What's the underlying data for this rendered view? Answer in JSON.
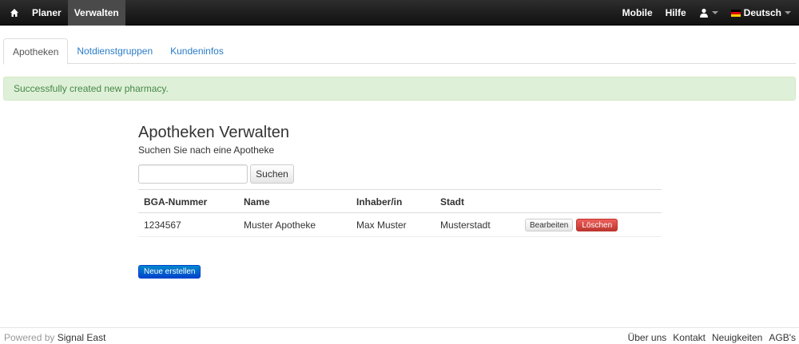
{
  "navbar": {
    "left": {
      "planner": "Planer",
      "manage": "Verwalten"
    },
    "right": {
      "mobile": "Mobile",
      "help": "Hilfe",
      "language": "Deutsch"
    }
  },
  "tabs": [
    {
      "label": "Apotheken",
      "active": true
    },
    {
      "label": "Notdienstgruppen",
      "active": false
    },
    {
      "label": "Kundeninfos",
      "active": false
    }
  ],
  "alert": {
    "message": "Successfully created new pharmacy."
  },
  "main": {
    "title": "Apotheken Verwalten",
    "subtitle": "Suchen Sie nach eine Apotheke",
    "search": {
      "value": "",
      "placeholder": "",
      "button": "Suchen"
    },
    "table": {
      "headers": [
        "BGA-Nummer",
        "Name",
        "Inhaber/in",
        "Stadt"
      ],
      "rows": [
        {
          "bga": "1234567",
          "name": "Muster Apotheke",
          "owner": "Max Muster",
          "city": "Musterstadt",
          "edit": "Bearbeiten",
          "delete": "Löschen"
        }
      ]
    },
    "new_button": "Neue erstellen"
  },
  "footer": {
    "powered_by": "Powered by",
    "brand": "Signal East",
    "links": [
      "Über uns",
      "Kontakt",
      "Neuigkeiten",
      "AGB's"
    ]
  },
  "colors": {
    "link": "#2a7cc7",
    "alert_bg": "#dff0d8",
    "alert_text": "#468847",
    "danger": "#bd362f",
    "primary": "#0044cc"
  },
  "icons": {
    "home": "home-icon",
    "user": "user-icon",
    "flag": "german-flag-icon"
  }
}
